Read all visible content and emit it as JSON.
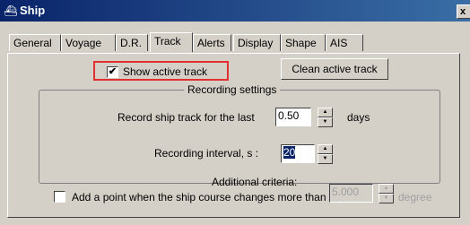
{
  "window": {
    "title": "Ship",
    "icon": "ship-icon",
    "close": "x"
  },
  "tabs": [
    {
      "label": "General"
    },
    {
      "label": "Voyage"
    },
    {
      "label": "D.R."
    },
    {
      "label": "Track",
      "active": true
    },
    {
      "label": "Alerts"
    },
    {
      "label": "Display"
    },
    {
      "label": "Shape"
    },
    {
      "label": "AIS"
    }
  ],
  "track": {
    "show_active_track": {
      "label": "Show active track",
      "checked": true
    },
    "clean_button": "Clean active track",
    "recording": {
      "legend": "Recording settings",
      "record_label": "Record ship track for the last",
      "record_value": "0.50",
      "record_unit": "days",
      "interval_label": "Recording interval, s :",
      "interval_value": "20",
      "additional_label": "Additional criteria:",
      "course_change_label": "Add a point when the ship course changes more than",
      "course_change_checked": false,
      "course_change_value": "5.000",
      "course_change_unit": "degree"
    }
  },
  "colors": {
    "highlight": "#e03030",
    "titlebar": "#0a246a"
  }
}
